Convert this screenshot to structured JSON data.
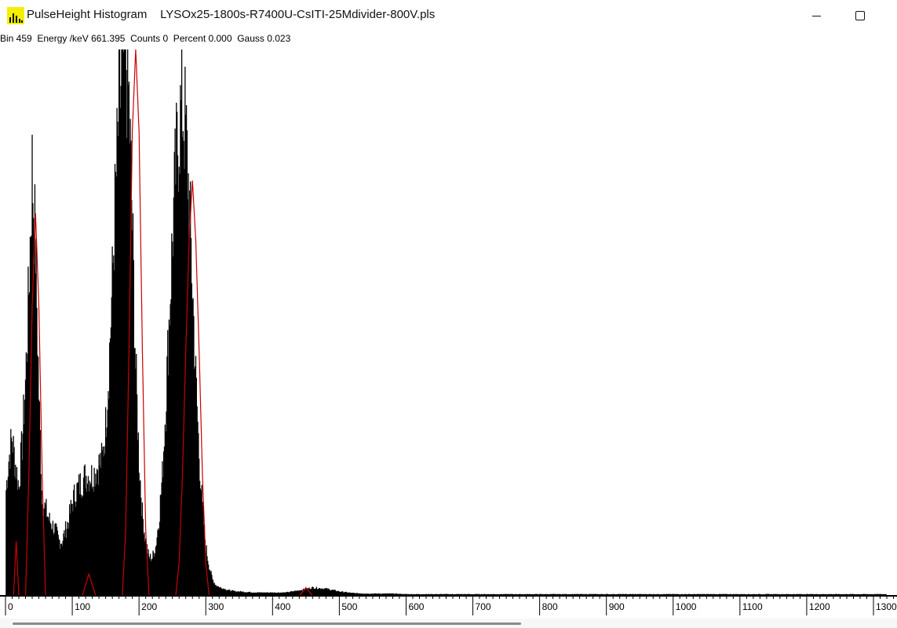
{
  "window": {
    "app_name": "PulseHeight Histogram",
    "file_name": "LYSOx25-1800s-R7400U-CsITI-25Mdivider-800V.pls",
    "icon": "histogram-app-icon",
    "controls": {
      "minimize_icon": "minimize-icon",
      "maximize_icon": "maximize-icon"
    }
  },
  "readout": {
    "text": "Bin 459  Energy /keV 661.395  Counts 0  Percent 0.000  Gauss 0.023",
    "bin": 459,
    "energy_kev": 661.395,
    "counts": 0,
    "percent": 0.0,
    "gauss": 0.023
  },
  "chart_data": {
    "type": "bar",
    "title": "",
    "xlabel": "",
    "ylabel": "",
    "xlim": [
      0,
      1320
    ],
    "x_ticks": [
      "0",
      "100",
      "200",
      "300",
      "400",
      "500",
      "600",
      "700",
      "800",
      "900",
      "1000",
      "1100",
      "1200",
      "1300"
    ],
    "grid": false,
    "colors": {
      "histogram": "#000000",
      "gauss_fit": "#cc0000",
      "axis": "#000000"
    },
    "series": [
      {
        "name": "",
        "type": "histogram",
        "x": [
          0,
          5,
          10,
          15,
          20,
          25,
          30,
          35,
          40,
          45,
          50,
          55,
          60,
          65,
          70,
          75,
          80,
          85,
          90,
          95,
          100,
          105,
          110,
          115,
          120,
          125,
          130,
          135,
          140,
          145,
          150,
          155,
          160,
          165,
          170,
          175,
          180,
          185,
          190,
          195,
          200,
          205,
          210,
          215,
          220,
          225,
          230,
          235,
          240,
          245,
          250,
          255,
          260,
          265,
          270,
          275,
          280,
          285,
          290,
          295,
          300,
          305,
          310,
          315,
          320,
          325,
          330,
          335,
          340,
          345,
          350,
          360,
          380,
          400,
          420,
          440,
          460,
          480,
          500,
          520,
          540,
          560,
          580,
          600,
          700,
          800,
          900,
          1000,
          1100,
          1200,
          1300
        ],
        "values": [
          0.18,
          0.25,
          0.29,
          0.24,
          0.2,
          0.28,
          0.39,
          0.56,
          0.78,
          0.64,
          0.37,
          0.17,
          0.16,
          0.14,
          0.13,
          0.12,
          0.1,
          0.1,
          0.12,
          0.14,
          0.17,
          0.19,
          0.2,
          0.21,
          0.22,
          0.22,
          0.22,
          0.23,
          0.24,
          0.25,
          0.31,
          0.42,
          0.57,
          0.74,
          0.88,
          0.97,
          1.0,
          0.9,
          0.68,
          0.42,
          0.25,
          0.15,
          0.1,
          0.07,
          0.07,
          0.09,
          0.14,
          0.22,
          0.35,
          0.5,
          0.65,
          0.78,
          0.86,
          0.9,
          0.85,
          0.73,
          0.57,
          0.4,
          0.26,
          0.16,
          0.09,
          0.055,
          0.03,
          0.02,
          0.016,
          0.014,
          0.012,
          0.01,
          0.009,
          0.008,
          0.008,
          0.007,
          0.006,
          0.006,
          0.006,
          0.01,
          0.015,
          0.013,
          0.008,
          0.005,
          0.004,
          0.004,
          0.004,
          0.003,
          0.003,
          0.003,
          0.003,
          0.003,
          0.003,
          0.003,
          0.003
        ]
      },
      {
        "name": "",
        "type": "line",
        "x": [
          0,
          5,
          8,
          12,
          16,
          20,
          25,
          30,
          35,
          40,
          45,
          50,
          55,
          60,
          65,
          90,
          100,
          110,
          115,
          120,
          125,
          130,
          135,
          140,
          175,
          180,
          185,
          190,
          195,
          200,
          205,
          210,
          215,
          255,
          260,
          265,
          270,
          275,
          280,
          285,
          290,
          295,
          300,
          305,
          310,
          315,
          320,
          440,
          450,
          460,
          470,
          1320
        ],
        "values": [
          0.0,
          0.0,
          0.0,
          0.0,
          0.1,
          0.0,
          0.0,
          0.0,
          0.22,
          0.53,
          0.7,
          0.53,
          0.22,
          0.0,
          0.0,
          0.0,
          0.0,
          0.0,
          0.0,
          0.02,
          0.04,
          0.02,
          0.0,
          0.0,
          0.0,
          0.12,
          0.45,
          0.85,
          1.0,
          0.85,
          0.45,
          0.12,
          0.0,
          0.0,
          0.06,
          0.22,
          0.45,
          0.65,
          0.76,
          0.65,
          0.45,
          0.22,
          0.06,
          0.0,
          0.0,
          0.0,
          0.0,
          0.0,
          0.015,
          0.0,
          0.0,
          0.0
        ]
      }
    ]
  }
}
